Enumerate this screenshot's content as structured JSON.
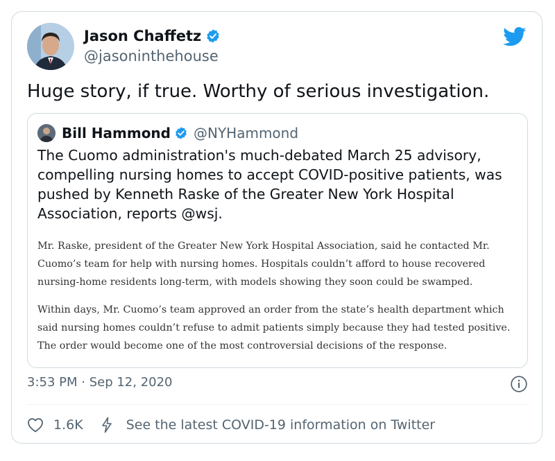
{
  "tweet": {
    "author_name": "Jason Chaffetz",
    "author_handle": "@jasoninthehouse",
    "text": "Huge story, if true. Worthy of serious investigation.",
    "timestamp": "3:53 PM · Sep 12, 2020",
    "likes": "1.6K",
    "covid_link": "See the latest COVID-19 information on Twitter"
  },
  "quote": {
    "author_name": "Bill Hammond",
    "author_handle": "@NYHammond",
    "text": "The Cuomo administration's much-debated March 25 advisory, compelling nursing homes to accept COVID-positive patients, was pushed by Kenneth Raske of the Greater New York Hospital Association, reports @wsj.",
    "excerpt": [
      "Mr. Raske, president of the Greater New York Hospital Association, said he contacted Mr. Cuomo’s team for help with nursing homes. Hospitals couldn’t afford to house recovered nursing-home residents long-term, with models showing they soon could be swamped.",
      "Within days, Mr. Cuomo’s team approved an order from the state’s health department which said nursing homes couldn’t refuse to admit patients simply because they had tested positive. The order would become one of the most controversial decisions of the response."
    ]
  },
  "icons": {
    "verified": "verified-badge-icon",
    "brand": "twitter-bird-icon",
    "info": "info-icon",
    "like": "heart-icon",
    "covid": "lightning-icon"
  },
  "colors": {
    "brand": "#1d9bf0",
    "text": "#0f1419",
    "secondary": "#536471",
    "border": "#cfd9de"
  }
}
